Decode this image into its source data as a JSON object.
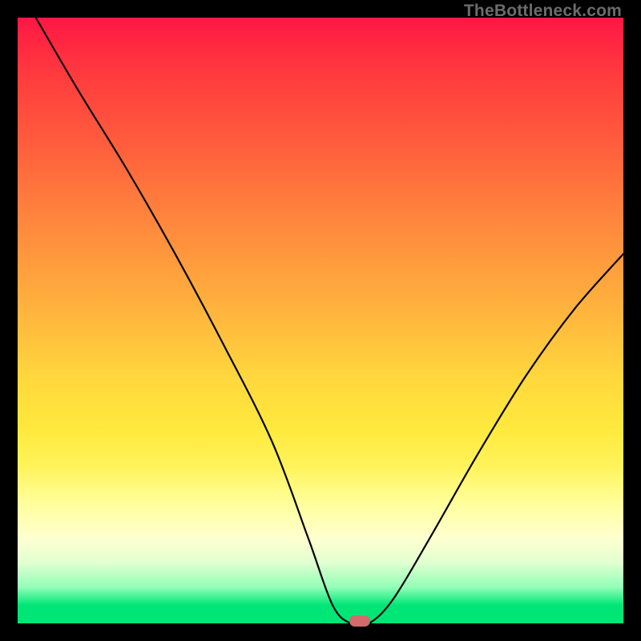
{
  "watermark": "TheBottleneck.com",
  "chart_data": {
    "type": "line",
    "title": "",
    "xlabel": "",
    "ylabel": "",
    "xlim": [
      0,
      100
    ],
    "ylim": [
      0,
      100
    ],
    "grid": false,
    "series": [
      {
        "name": "bottleneck-curve",
        "x": [
          3,
          10,
          18,
          26,
          34,
          42,
          48,
          52,
          55,
          58,
          62,
          68,
          76,
          84,
          92,
          100
        ],
        "y": [
          100,
          88,
          75,
          61,
          46,
          30,
          14,
          3,
          0,
          0,
          4,
          14,
          28,
          41,
          52,
          61
        ]
      }
    ],
    "marker": {
      "x": 56.5,
      "y": 0
    },
    "background": {
      "gradient_stops": [
        {
          "pos": 0,
          "color": "#ff1744"
        },
        {
          "pos": 50,
          "color": "#ffd93d"
        },
        {
          "pos": 86,
          "color": "#ffffd0"
        },
        {
          "pos": 100,
          "color": "#00e676"
        }
      ]
    }
  }
}
